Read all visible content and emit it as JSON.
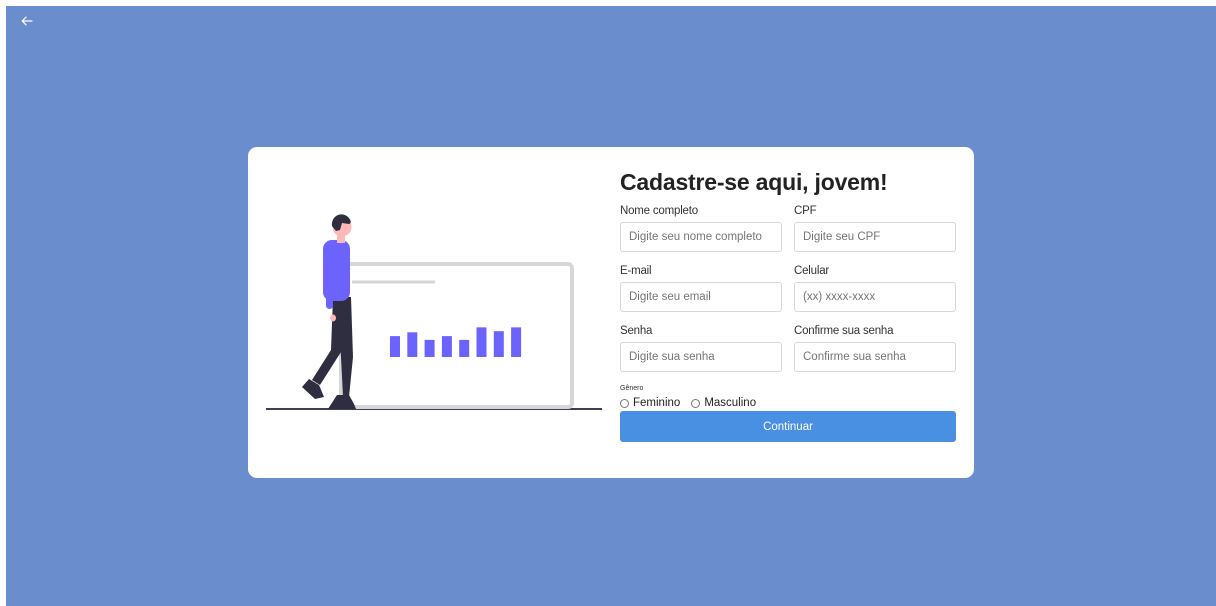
{
  "nav": {
    "back_icon": "arrow-left-icon"
  },
  "colors": {
    "background": "#6a8ecd",
    "card": "#ffffff",
    "accent": "#4a90e2",
    "illustration_accent": "#6c63ff"
  },
  "illustration": {
    "name": "person-with-bar-chart",
    "bars": [
      0.55,
      0.65,
      0.45,
      0.55,
      0.45,
      0.78,
      0.68,
      0.78
    ]
  },
  "form": {
    "title": "Cadastre-se aqui, jovem!",
    "fields": [
      {
        "label": "Nome completo",
        "placeholder": "Digite seu nome completo"
      },
      {
        "label": "CPF",
        "placeholder": "Digite seu CPF"
      },
      {
        "label": "E-mail",
        "placeholder": "Digite seu email"
      },
      {
        "label": "Celular",
        "placeholder": "(xx) xxxx-xxxx"
      },
      {
        "label": "Senha",
        "placeholder": "Digite sua senha"
      },
      {
        "label": "Confirme sua senha",
        "placeholder": "Confirme sua senha"
      }
    ],
    "gender": {
      "label": "Gênero",
      "options": [
        {
          "label": "Feminino"
        },
        {
          "label": "Masculino"
        }
      ]
    },
    "submit_label": "Continuar"
  }
}
